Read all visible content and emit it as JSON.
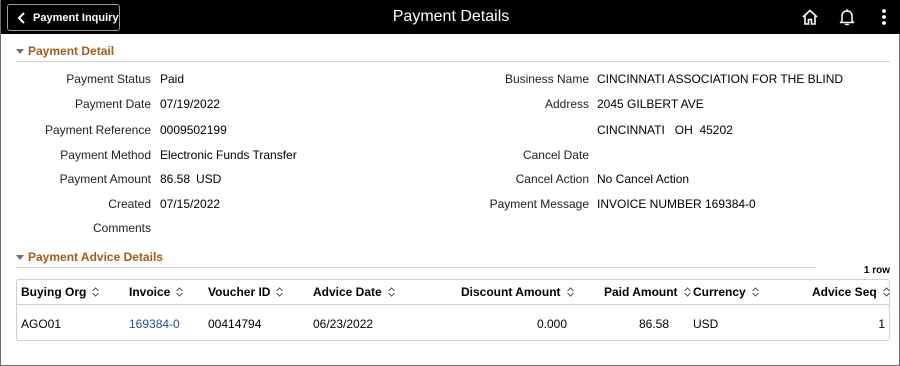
{
  "header": {
    "back_label": "Payment Inquiry",
    "title": "Payment Details",
    "icons": [
      "home-icon",
      "bell-icon",
      "more-vertical-icon"
    ]
  },
  "payment_detail": {
    "section_title": "Payment Detail",
    "left": [
      {
        "label": "Payment Status",
        "value": "Paid"
      },
      {
        "label": "Payment Date",
        "value": "07/19/2022"
      },
      {
        "label": "Payment Reference",
        "value": "0009502199"
      },
      {
        "label": "Payment Method",
        "value": "Electronic Funds Transfer"
      },
      {
        "label": "Payment Amount",
        "value": "86.58",
        "currency": "USD"
      },
      {
        "label": "Created",
        "value": "07/15/2022"
      },
      {
        "label": "Comments",
        "value": ""
      }
    ],
    "right": [
      {
        "label": "Business Name",
        "value": "CINCINNATI ASSOCIATION FOR THE BLIND"
      },
      {
        "label": "Address",
        "value": "2045 GILBERT AVE"
      },
      {
        "label": "",
        "value": "CINCINNATI   OH  45202"
      },
      {
        "label": "Cancel Date",
        "value": ""
      },
      {
        "label": "Cancel Action",
        "value": "No Cancel Action"
      },
      {
        "label": "Payment Message",
        "value": "INVOICE NUMBER 169384-0"
      }
    ]
  },
  "advice": {
    "section_title": "Payment Advice Details",
    "row_count": "1 row",
    "columns": [
      "Buying Org",
      "Invoice",
      "Voucher ID",
      "Advice Date",
      "Discount Amount",
      "Paid Amount",
      "Currency",
      "Advice Seq"
    ],
    "rows": [
      {
        "buying_org": "AGO01",
        "invoice": "169384-0",
        "voucher_id": "00414794",
        "advice_date": "06/23/2022",
        "discount_amount": "0.000",
        "paid_amount": "86.58",
        "currency": "USD",
        "advice_seq": "1"
      }
    ]
  },
  "colors": {
    "header_bg": "#000000",
    "section_title": "#a65a16",
    "link": "#1f4e8c"
  }
}
